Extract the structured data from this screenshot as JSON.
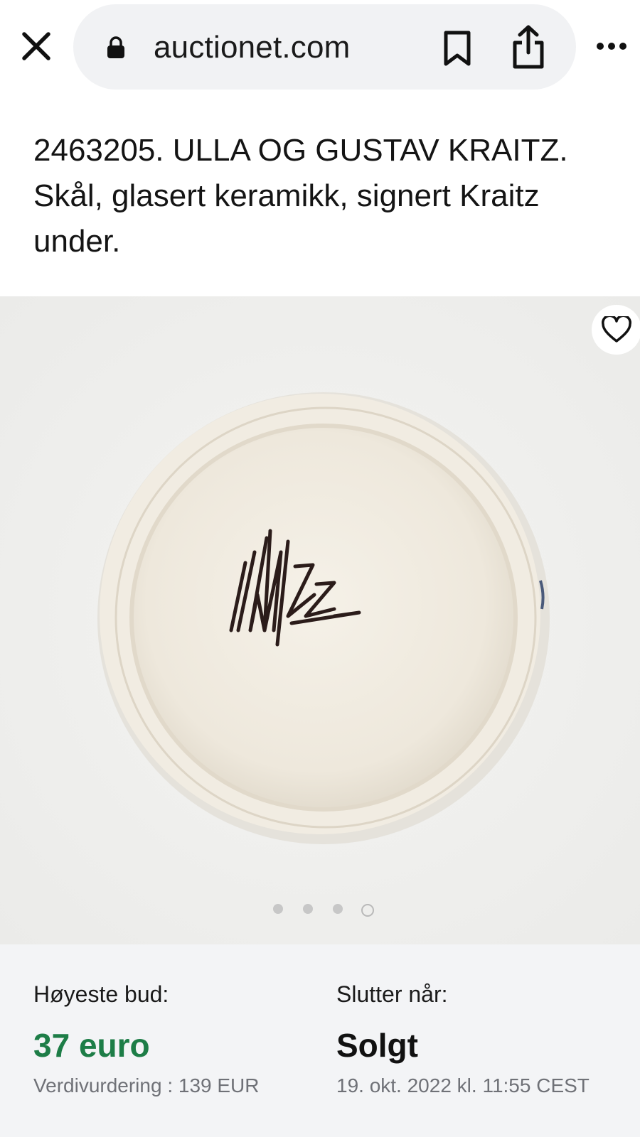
{
  "browser": {
    "url": "auctionet.com",
    "icons": [
      "close-icon",
      "lock-icon",
      "bookmark-icon",
      "share-icon",
      "more-icon"
    ]
  },
  "lot": {
    "title": "2463205. ULLA OG GUSTAV KRAITZ. Skål, glasert keramikk, signert Kraitz under."
  },
  "gallery": {
    "image_count": 4,
    "active_index": 4,
    "signature_text": "Kraitz",
    "favorite_icon": "heart-icon"
  },
  "bidding": {
    "highest_bid_label": "Høyeste bud:",
    "highest_bid_value": "37 euro",
    "estimate": "Verdivurdering : 139 EUR",
    "ends_label": "Slutter når:",
    "status": "Solgt",
    "end_date": "19. okt. 2022 kl. 11:55 CEST"
  },
  "colors": {
    "accent_green": "#1d7d47",
    "urlbar_bg": "#f1f2f4",
    "info_bg": "#f3f4f6"
  }
}
